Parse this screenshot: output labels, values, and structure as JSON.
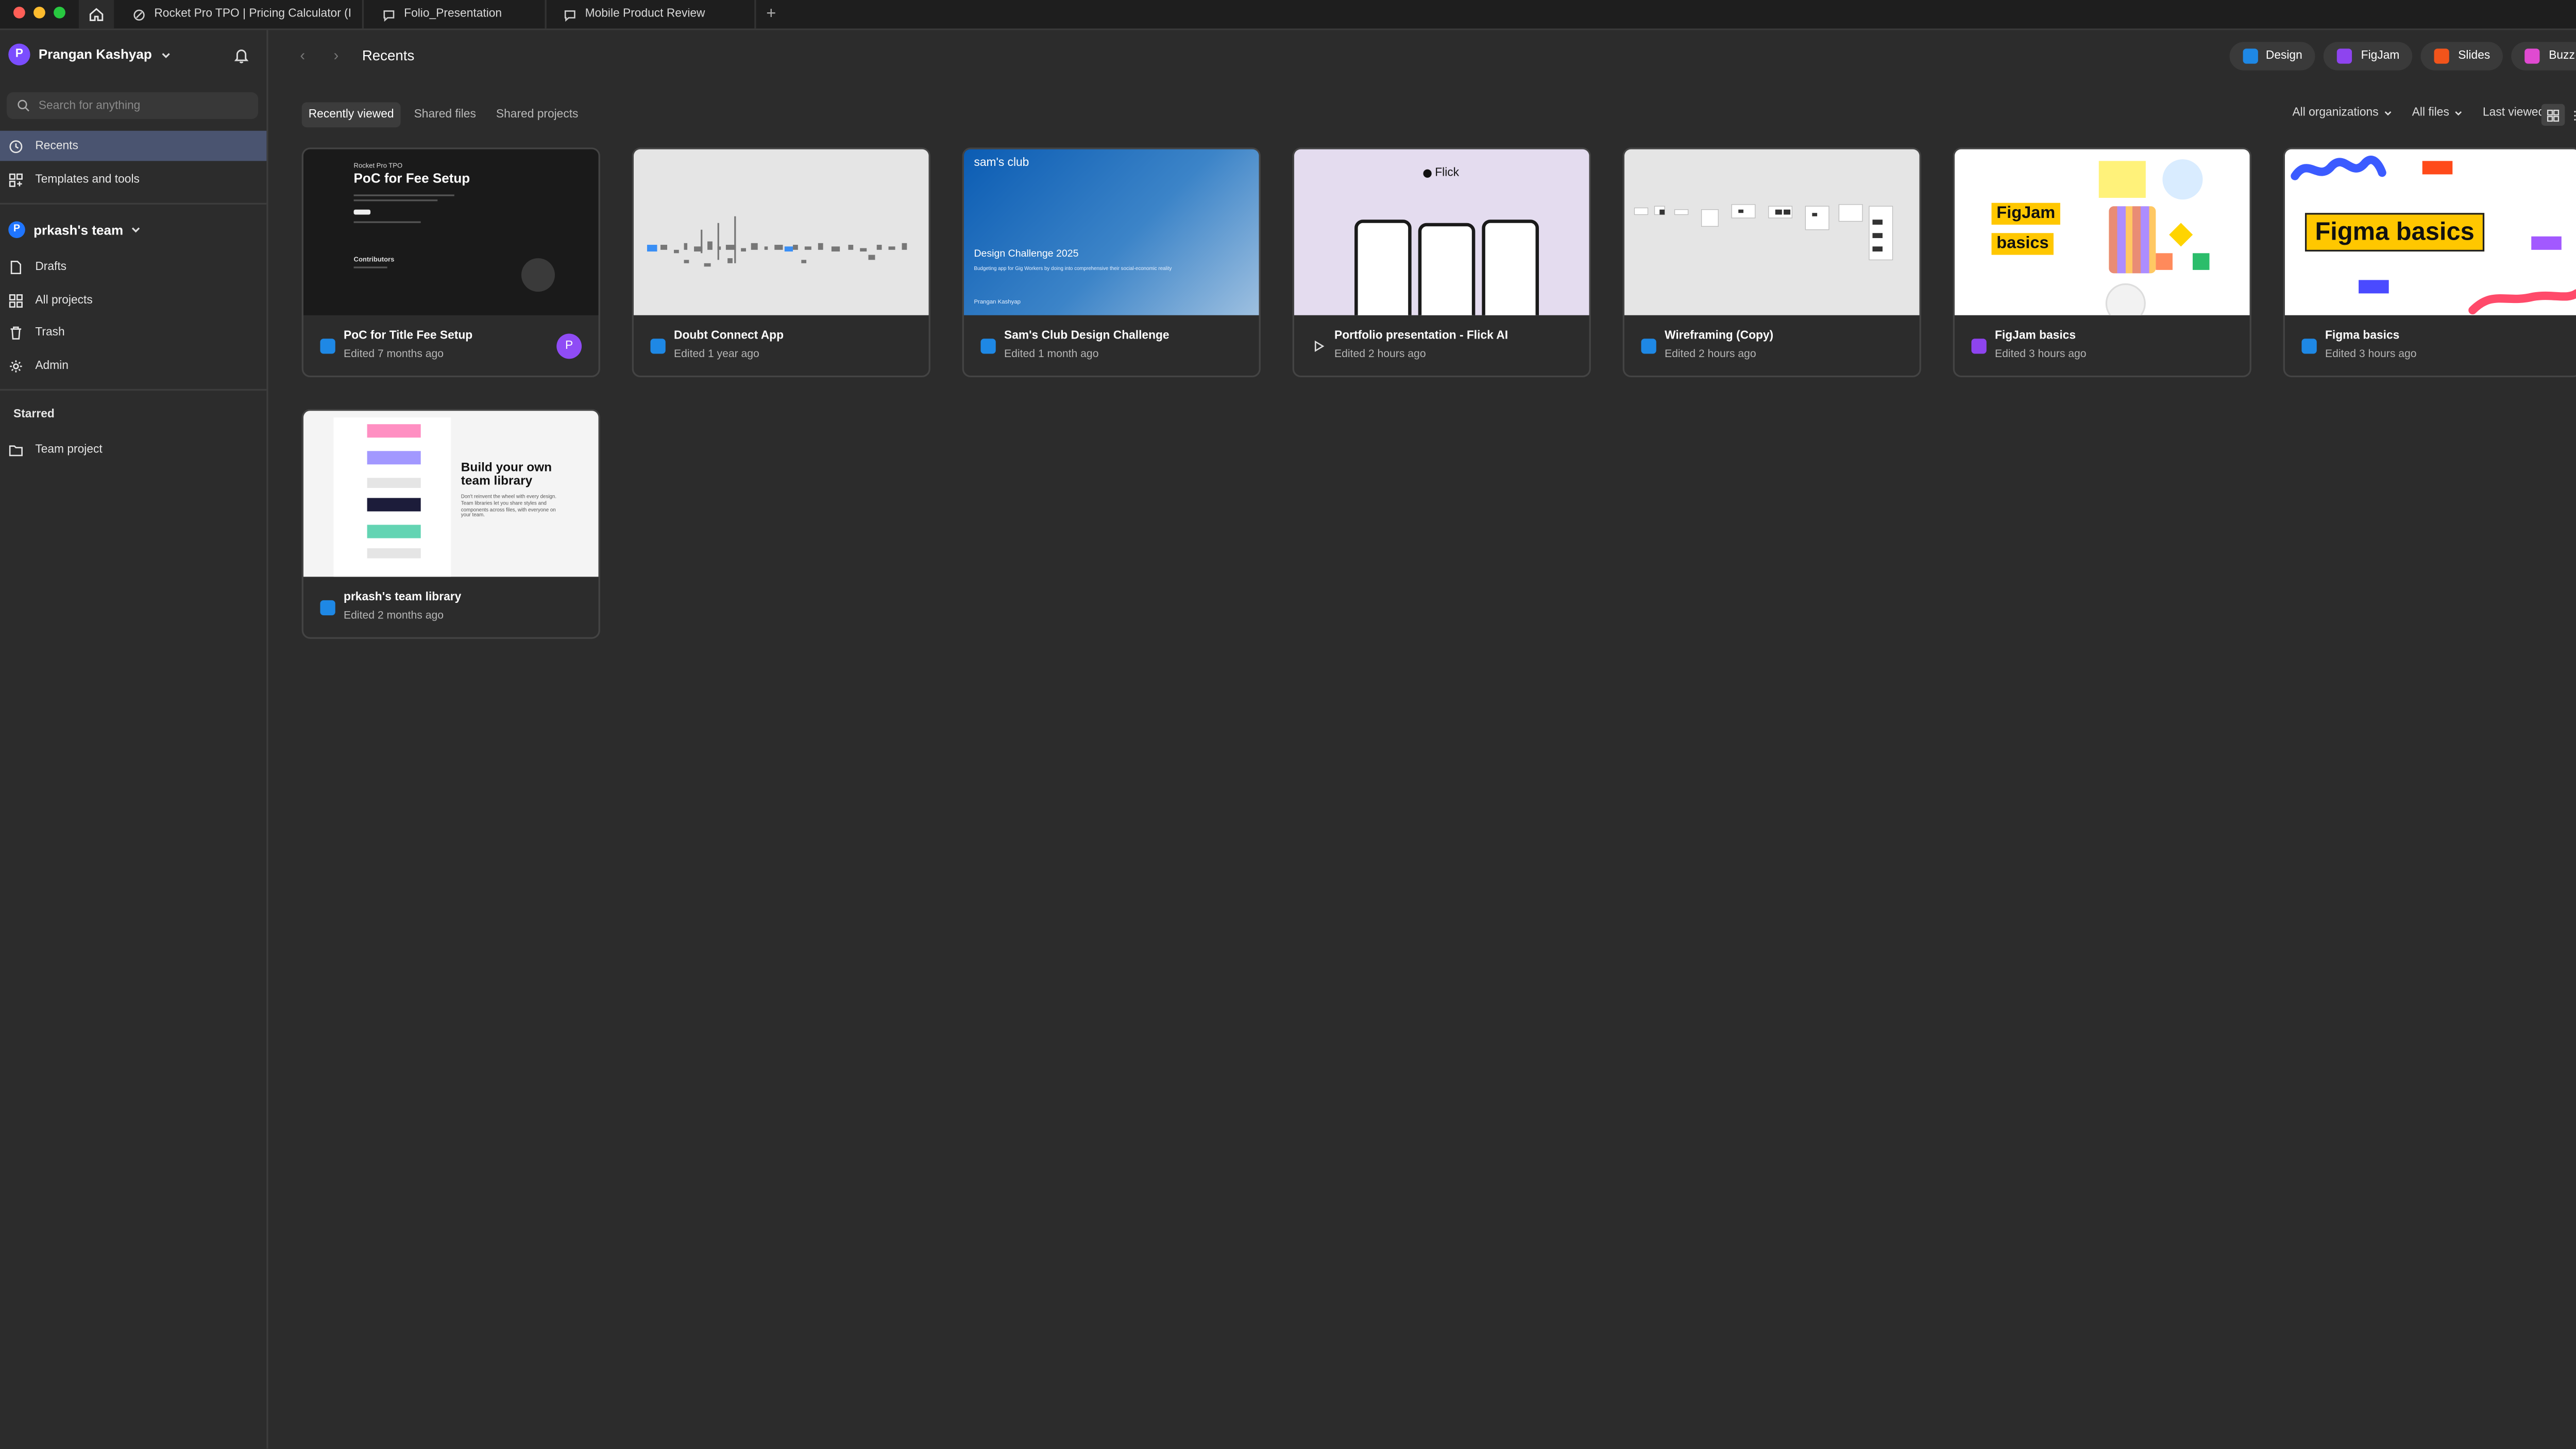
{
  "tabs": [
    {
      "label": "Rocket Pro TPO | Pricing Calculator (I"
    },
    {
      "label": "Folio_Presentation"
    },
    {
      "label": "Mobile Product Review"
    }
  ],
  "sidebar": {
    "user_initial": "P",
    "user_name": "Prangan Kashyap",
    "search_placeholder": "Search for anything",
    "nav": [
      {
        "label": "Recents"
      },
      {
        "label": "Templates and tools"
      }
    ],
    "team_initial": "P",
    "team_name": "prkash's team",
    "team_nav": [
      {
        "label": "Drafts"
      },
      {
        "label": "All projects"
      },
      {
        "label": "Trash"
      },
      {
        "label": "Admin"
      }
    ],
    "starred_heading": "Starred",
    "starred": [
      {
        "label": "Team project"
      }
    ]
  },
  "header": {
    "title": "Recents",
    "apps": [
      {
        "label": "Design",
        "color": "#1e88e5"
      },
      {
        "label": "FigJam",
        "color": "#8e44ef"
      },
      {
        "label": "Slides",
        "color": "#f2541b"
      },
      {
        "label": "Buzz",
        "color": "#e04ad1"
      }
    ]
  },
  "filter_tabs": [
    "Recently viewed",
    "Shared files",
    "Shared projects"
  ],
  "filters": {
    "org": "All organizations",
    "files": "All files",
    "sort": "Last viewed"
  },
  "files": [
    {
      "title": "PoC for Title Fee Setup",
      "edited": "Edited 7 months ago",
      "type": "design",
      "owner_initial": "P",
      "thumb": {
        "eyebrow": "Rocket Pro TPO",
        "heading": "PoC for Fee Setup",
        "contributors": "Contributors",
        "logo": "ROCKET\nPRO TPO"
      }
    },
    {
      "title": "Doubt Connect App",
      "edited": "Edited 1 year ago",
      "type": "design"
    },
    {
      "title": "Sam's Club Design Challenge",
      "edited": "Edited 1 month ago",
      "type": "design",
      "thumb": {
        "brand": "sam's club",
        "heading": "Design Challenge 2025",
        "sub": "Budgeting app for Gig Workers by doing into comprehensive their social-economic reality",
        "author": "Prangan Kashyap"
      }
    },
    {
      "title": "Portfolio presentation - Flick AI",
      "edited": "Edited 2 hours ago",
      "type": "play",
      "thumb": {
        "brand": "Flick"
      }
    },
    {
      "title": "Wireframing (Copy)",
      "edited": "Edited 2 hours ago",
      "type": "design"
    },
    {
      "title": "FigJam basics",
      "edited": "Edited 3 hours ago",
      "type": "figjam",
      "thumb": {
        "line1": "FigJam",
        "line2": "basics"
      }
    },
    {
      "title": "Figma basics",
      "edited": "Edited 3 hours ago",
      "type": "design",
      "thumb": {
        "heading": "Figma basics"
      }
    },
    {
      "title": "prkash's team library",
      "edited": "Edited 2 months ago",
      "type": "design",
      "thumb": {
        "heading": "Build your own team library",
        "body": "Don't reinvent the wheel with every design. Team libraries let you share styles and components across files, with everyone on your team."
      }
    }
  ],
  "help_label": "?"
}
